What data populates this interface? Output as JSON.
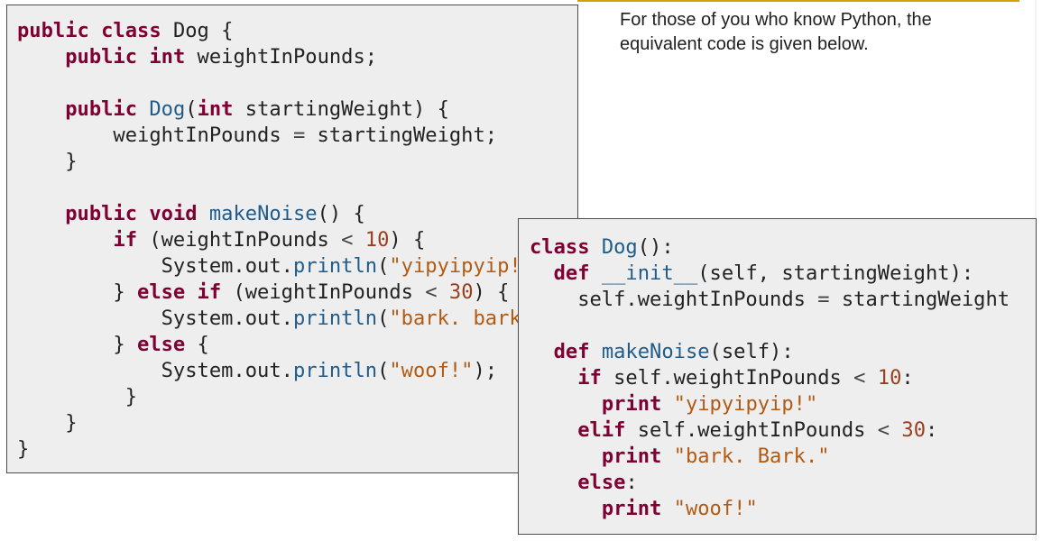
{
  "caption": "For those of you who know Python, the equivalent code is given below.",
  "java_code": {
    "lines": [
      [
        [
          "kw",
          "public"
        ],
        [
          "pl",
          " "
        ],
        [
          "kw",
          "class"
        ],
        [
          "pl",
          " Dog {"
        ]
      ],
      [
        [
          "pl",
          "    "
        ],
        [
          "kw",
          "public"
        ],
        [
          "pl",
          " "
        ],
        [
          "kw",
          "int"
        ],
        [
          "pl",
          " weightInPounds;"
        ]
      ],
      [
        [
          "pl",
          ""
        ]
      ],
      [
        [
          "pl",
          "    "
        ],
        [
          "kw",
          "public"
        ],
        [
          "pl",
          " "
        ],
        [
          "fn",
          "Dog"
        ],
        [
          "pl",
          "("
        ],
        [
          "kw",
          "int"
        ],
        [
          "pl",
          " startingWeight) {"
        ]
      ],
      [
        [
          "pl",
          "        weightInPounds "
        ],
        [
          "op",
          "="
        ],
        [
          "pl",
          " startingWeight;"
        ]
      ],
      [
        [
          "pl",
          "    }"
        ]
      ],
      [
        [
          "pl",
          ""
        ]
      ],
      [
        [
          "pl",
          "    "
        ],
        [
          "kw",
          "public"
        ],
        [
          "pl",
          " "
        ],
        [
          "kw",
          "void"
        ],
        [
          "pl",
          " "
        ],
        [
          "fn",
          "makeNoise"
        ],
        [
          "pl",
          "() {"
        ]
      ],
      [
        [
          "pl",
          "        "
        ],
        [
          "kw",
          "if"
        ],
        [
          "pl",
          " (weightInPounds "
        ],
        [
          "op",
          "<"
        ],
        [
          "pl",
          " "
        ],
        [
          "num",
          "10"
        ],
        [
          "pl",
          ") {"
        ]
      ],
      [
        [
          "pl",
          "            System.out."
        ],
        [
          "fn",
          "println"
        ],
        [
          "pl",
          "("
        ],
        [
          "str",
          "\"yipyipyip!\""
        ],
        [
          "pl",
          ");"
        ]
      ],
      [
        [
          "pl",
          "        } "
        ],
        [
          "kw",
          "else"
        ],
        [
          "pl",
          " "
        ],
        [
          "kw",
          "if"
        ],
        [
          "pl",
          " (weightInPounds "
        ],
        [
          "op",
          "<"
        ],
        [
          "pl",
          " "
        ],
        [
          "num",
          "30"
        ],
        [
          "pl",
          ") {"
        ]
      ],
      [
        [
          "pl",
          "            System.out."
        ],
        [
          "fn",
          "println"
        ],
        [
          "pl",
          "("
        ],
        [
          "str",
          "\"bark. bark.\""
        ],
        [
          "pl",
          ");"
        ]
      ],
      [
        [
          "pl",
          "        } "
        ],
        [
          "kw",
          "else"
        ],
        [
          "pl",
          " {"
        ]
      ],
      [
        [
          "pl",
          "            System.out."
        ],
        [
          "fn",
          "println"
        ],
        [
          "pl",
          "("
        ],
        [
          "str",
          "\"woof!\""
        ],
        [
          "pl",
          ");"
        ]
      ],
      [
        [
          "pl",
          "         }"
        ]
      ],
      [
        [
          "pl",
          "    }"
        ]
      ],
      [
        [
          "pl",
          "}"
        ]
      ]
    ]
  },
  "python_code": {
    "lines": [
      [
        [
          "kw",
          "class"
        ],
        [
          "pl",
          " "
        ],
        [
          "fn",
          "Dog"
        ],
        [
          "pl",
          "():"
        ]
      ],
      [
        [
          "pl",
          "  "
        ],
        [
          "kw",
          "def"
        ],
        [
          "pl",
          " "
        ],
        [
          "fn",
          "__init__"
        ],
        [
          "pl",
          "(self, startingWeight):"
        ]
      ],
      [
        [
          "pl",
          "    self.weightInPounds "
        ],
        [
          "op",
          "="
        ],
        [
          "pl",
          " startingWeight"
        ]
      ],
      [
        [
          "pl",
          ""
        ]
      ],
      [
        [
          "pl",
          "  "
        ],
        [
          "kw",
          "def"
        ],
        [
          "pl",
          " "
        ],
        [
          "fn",
          "makeNoise"
        ],
        [
          "pl",
          "(self):"
        ]
      ],
      [
        [
          "pl",
          "    "
        ],
        [
          "kw",
          "if"
        ],
        [
          "pl",
          " self.weightInPounds "
        ],
        [
          "op",
          "<"
        ],
        [
          "pl",
          " "
        ],
        [
          "num",
          "10"
        ],
        [
          "pl",
          ":"
        ]
      ],
      [
        [
          "pl",
          "      "
        ],
        [
          "kw",
          "print"
        ],
        [
          "pl",
          " "
        ],
        [
          "str",
          "\"yipyipyip!\""
        ]
      ],
      [
        [
          "pl",
          "    "
        ],
        [
          "kw",
          "elif"
        ],
        [
          "pl",
          " self.weightInPounds "
        ],
        [
          "op",
          "<"
        ],
        [
          "pl",
          " "
        ],
        [
          "num",
          "30"
        ],
        [
          "pl",
          ":"
        ]
      ],
      [
        [
          "pl",
          "      "
        ],
        [
          "kw",
          "print"
        ],
        [
          "pl",
          " "
        ],
        [
          "str",
          "\"bark. Bark.\""
        ]
      ],
      [
        [
          "pl",
          "    "
        ],
        [
          "kw",
          "else"
        ],
        [
          "pl",
          ":"
        ]
      ],
      [
        [
          "pl",
          "      "
        ],
        [
          "kw",
          "print"
        ],
        [
          "pl",
          " "
        ],
        [
          "str",
          "\"woof!\""
        ]
      ]
    ]
  }
}
